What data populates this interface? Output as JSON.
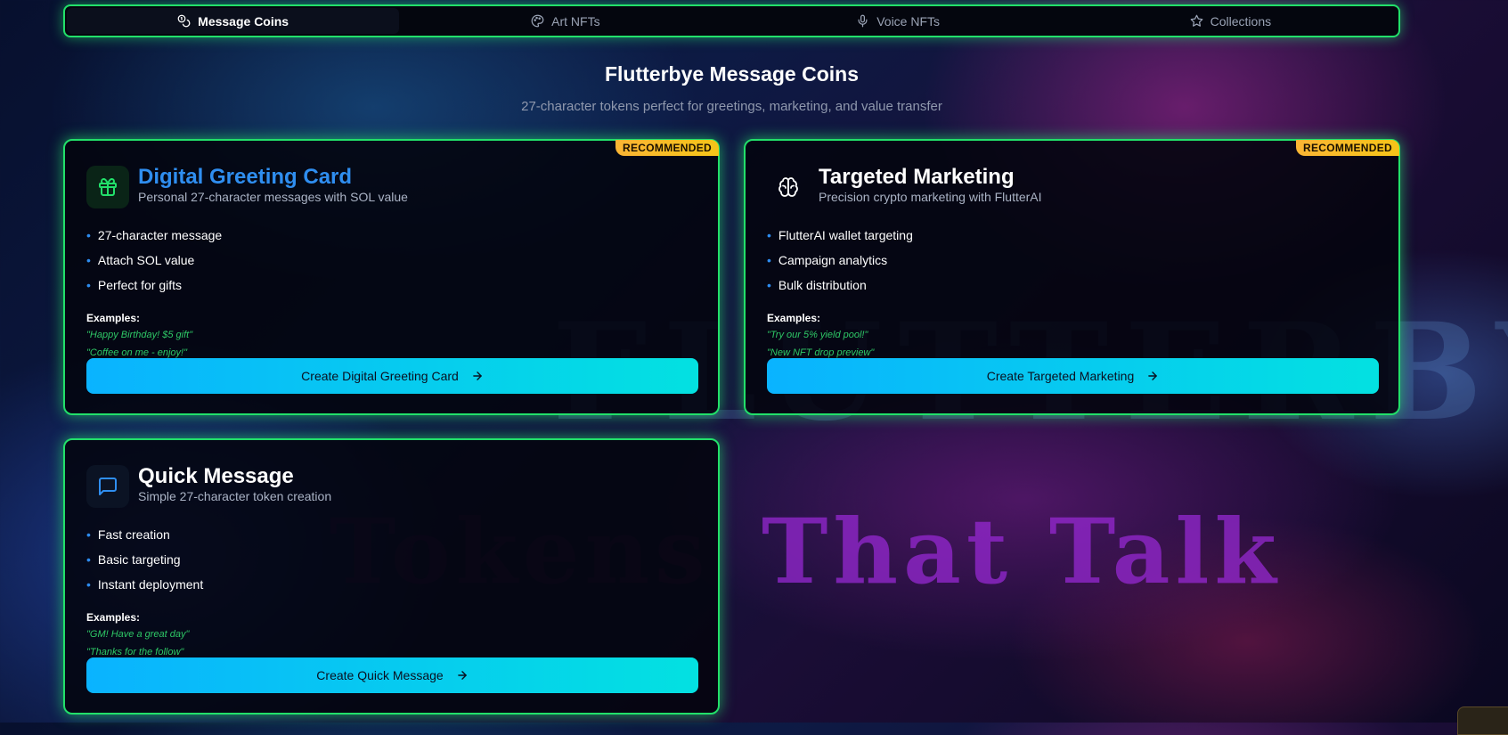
{
  "tabs": [
    {
      "label": "Message Coins",
      "icon": "coins-icon",
      "active": true
    },
    {
      "label": "Art NFTs",
      "icon": "palette-icon",
      "active": false
    },
    {
      "label": "Voice NFTs",
      "icon": "mic-icon",
      "active": false
    },
    {
      "label": "Collections",
      "icon": "star-icon",
      "active": false
    }
  ],
  "header": {
    "title": "Flutterbye Message Coins",
    "subtitle": "27-character tokens perfect for greetings, marketing, and value transfer"
  },
  "background": {
    "word1": "FLUTTERBYE",
    "word2": "Tokens",
    "word3": "That Talk"
  },
  "cards": [
    {
      "badge": "RECOMMENDED",
      "icon": "gift-icon",
      "title": "Digital Greeting Card",
      "description": "Personal 27-character messages with SOL value",
      "features": [
        "27-character message",
        "Attach SOL value",
        "Perfect for gifts"
      ],
      "examples_label": "Examples:",
      "examples": [
        "\"Happy Birthday! $5 gift\"",
        "\"Coffee on me - enjoy!\""
      ],
      "button": "Create Digital Greeting Card"
    },
    {
      "badge": "RECOMMENDED",
      "icon": "brain-icon",
      "title": "Targeted Marketing",
      "description": "Precision crypto marketing with FlutterAI",
      "features": [
        "FlutterAI wallet targeting",
        "Campaign analytics",
        "Bulk distribution"
      ],
      "examples_label": "Examples:",
      "examples": [
        "\"Try our 5% yield pool!\"",
        "\"New NFT drop preview\""
      ],
      "button": "Create Targeted Marketing"
    },
    {
      "badge": "",
      "icon": "message-square-icon",
      "title": "Quick Message",
      "description": "Simple 27-character token creation",
      "features": [
        "Fast creation",
        "Basic targeting",
        "Instant deployment"
      ],
      "examples_label": "Examples:",
      "examples": [
        "\"GM! Have a great day\"",
        "\"Thanks for the follow\""
      ],
      "button": "Create Quick Message"
    }
  ],
  "colors": {
    "accent_green": "#22e06a",
    "button_start": "#0ab3ff",
    "button_end": "#03e1e1",
    "badge": "#fbb534",
    "title_blue": "#2f8ef0",
    "example_green": "#2ec866"
  }
}
